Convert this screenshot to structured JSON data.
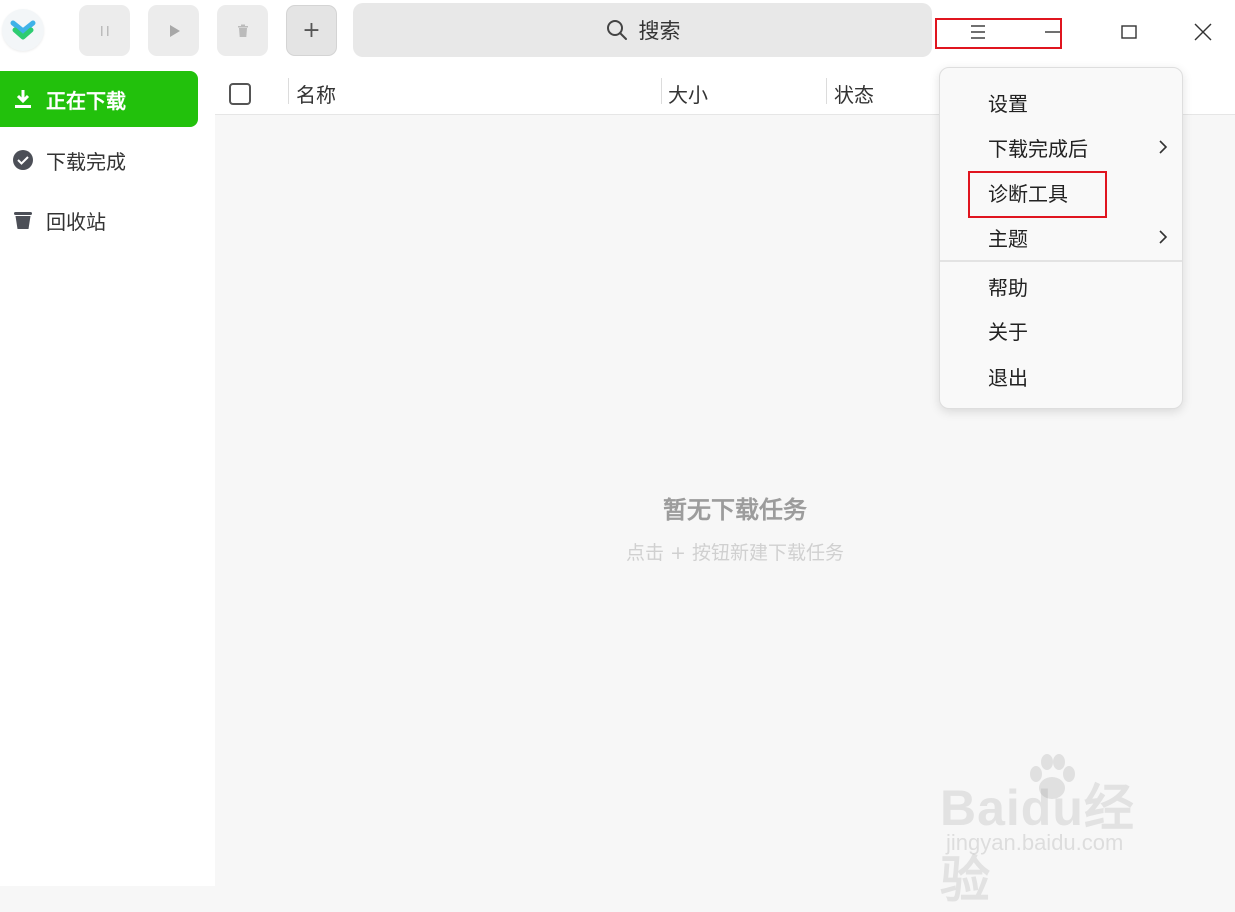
{
  "toolbar": {
    "search_label": "搜索",
    "add_symbol": "+"
  },
  "sidebar": {
    "items": [
      {
        "label": "正在下载",
        "icon": "download-icon",
        "active": true
      },
      {
        "label": "下载完成",
        "icon": "check-circle-icon",
        "active": false
      },
      {
        "label": "回收站",
        "icon": "trash-icon",
        "active": false
      }
    ]
  },
  "table": {
    "columns": [
      "名称",
      "大小",
      "状态"
    ]
  },
  "empty_state": {
    "title": "暂无下载任务",
    "subtitle": "点击 + 按钮新建下载任务"
  },
  "menu": {
    "items": [
      {
        "label": "设置",
        "submenu": false
      },
      {
        "label": "下载完成后",
        "submenu": true
      },
      {
        "label": "诊断工具",
        "submenu": false,
        "highlighted": true
      },
      {
        "label": "主题",
        "submenu": true
      },
      {
        "label": "帮助",
        "submenu": false
      },
      {
        "label": "关于",
        "submenu": false
      },
      {
        "label": "退出",
        "submenu": false
      }
    ]
  },
  "watermark": {
    "brand": "Baidu经验",
    "url": "jingyan.baidu.com"
  },
  "colors": {
    "accent": "#22c10c",
    "highlight_box": "#e0151f"
  }
}
